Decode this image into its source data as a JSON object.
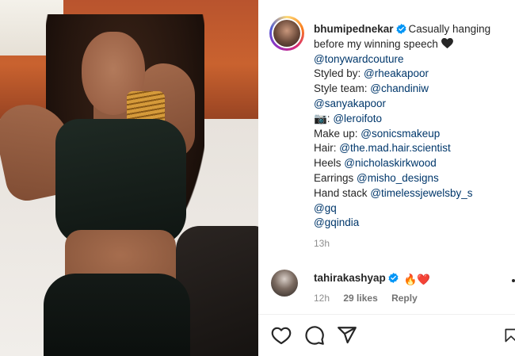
{
  "post": {
    "username": "bhumipednekar",
    "caption_lines": [
      "Casually hanging",
      "before my winning speech",
      "@tonywardcouture",
      "Styled by:",
      "@rheakapoor",
      "Style team:",
      "@chandiniw",
      "@sanyakapoor",
      "📷:",
      "@leroifoto",
      "Make up:",
      "@sonicsmakeup",
      "Hair:",
      "@the.mad.hair.scientist",
      "Heels",
      "@nicholaskirkwood",
      "Earrings",
      "@misho_designs",
      "Hand stack",
      "@timelessjewelsby_s",
      "@gq",
      "@gqindia"
    ],
    "time": "13h"
  },
  "comment": {
    "username": "tahirakashyap",
    "emojis": "🔥❤️",
    "time": "12h",
    "likes": "29 likes",
    "reply": "Reply"
  },
  "icons": {
    "verified": "verified-badge-icon",
    "black_heart": "black-heart-icon",
    "like": "heart-icon",
    "comment": "comment-icon",
    "share": "share-icon",
    "save": "bookmark-icon"
  },
  "colors": {
    "link": "#00376b",
    "verified": "#0095f6",
    "muted": "#8e8e8e"
  }
}
